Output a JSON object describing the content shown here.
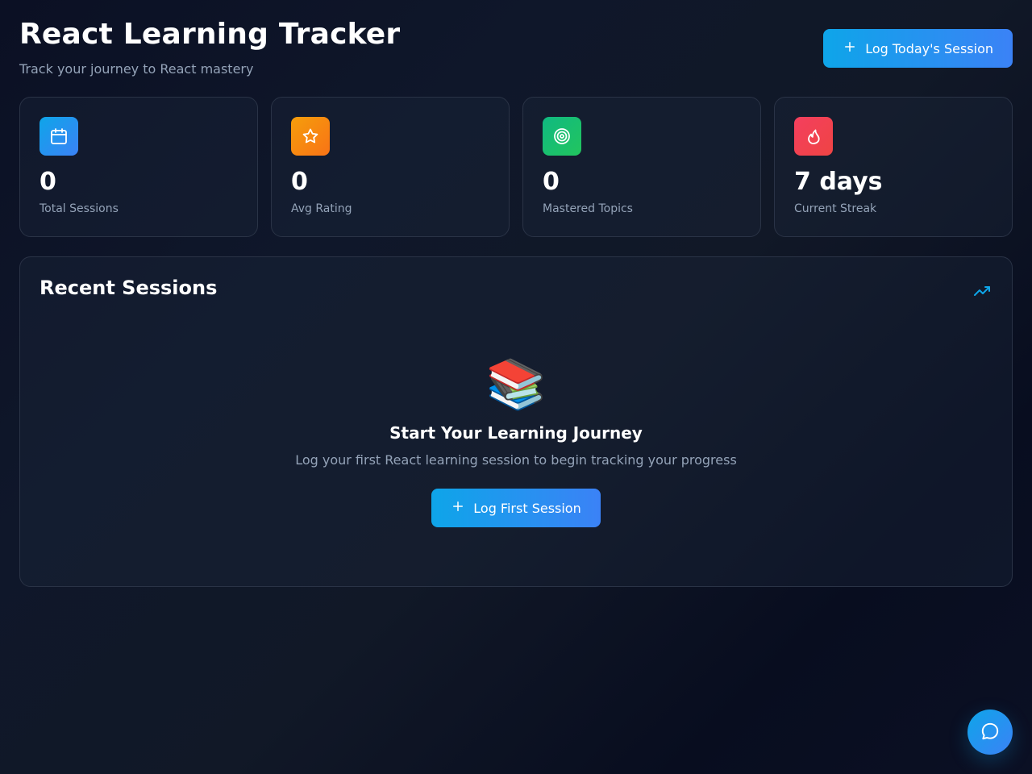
{
  "header": {
    "title": "React Learning Tracker",
    "subtitle": "Track your journey to React mastery",
    "log_button_label": "Log Today's Session"
  },
  "stats": [
    {
      "value": "0",
      "label": "Total Sessions",
      "icon": "calendar-icon",
      "color_from": "#0ea5e9",
      "color_to": "#3b82f6"
    },
    {
      "value": "0",
      "label": "Avg Rating",
      "icon": "star-icon",
      "color_from": "#f59e0b",
      "color_to": "#f97316"
    },
    {
      "value": "0",
      "label": "Mastered Topics",
      "icon": "target-icon",
      "color_from": "#10b981",
      "color_to": "#22c55e"
    },
    {
      "value": "7 days",
      "label": "Current Streak",
      "icon": "flame-icon",
      "color_from": "#f43f5e",
      "color_to": "#ef4444"
    }
  ],
  "recent_sessions": {
    "title": "Recent Sessions",
    "trend_icon": "trending-up-icon",
    "empty_state": {
      "emoji": "📚",
      "title": "Start Your Learning Journey",
      "description": "Log your first React learning session to begin tracking your progress",
      "button_label": "Log First Session"
    }
  },
  "chat": {
    "icon": "chat-bubble-icon"
  },
  "colors": {
    "accent": "#0ea5e9",
    "accent_secondary": "#3b82f6",
    "text_muted": "#94a3b8",
    "background": "#0f172a"
  }
}
